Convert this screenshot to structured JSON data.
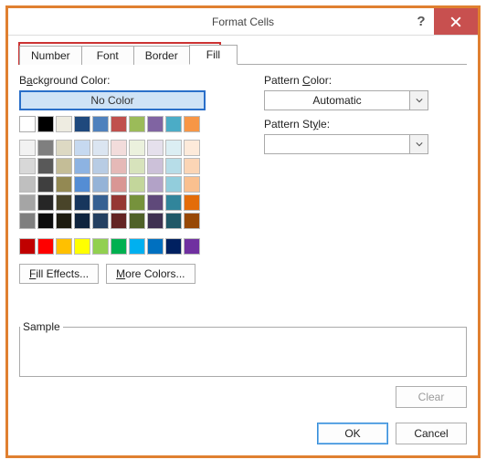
{
  "title": "Format Cells",
  "tabs": {
    "number": "Number",
    "font": "Font",
    "border": "Border",
    "fill": "Fill"
  },
  "active_tab": "fill",
  "bg_label_pre": "B",
  "bg_label_u": "a",
  "bg_label_post": "ckground Color:",
  "no_color": "No Color",
  "fill_effects_u": "F",
  "fill_effects_post": "ill Effects...",
  "more_colors_u": "M",
  "more_colors_post": "ore Colors...",
  "pat_color_pre": "Pattern ",
  "pat_color_u": "C",
  "pat_color_post": "olor:",
  "pat_color_value": "Automatic",
  "pat_style_pre": "Pattern St",
  "pat_style_u": "y",
  "pat_style_post": "le:",
  "pat_style_value": "",
  "sample_label": "Sample",
  "clear_u": "",
  "clear_label": "Clear",
  "ok_label": "OK",
  "cancel_label": "Cancel",
  "chart_data": {
    "type": "table",
    "title": "Fill color palette",
    "theme_colors_row1": [
      "#FFFFFF",
      "#000000",
      "#EEECE1",
      "#1F497D",
      "#4F81BD",
      "#C0504D",
      "#9BBB59",
      "#8064A2",
      "#4BACC6",
      "#F79646"
    ],
    "theme_tints": [
      [
        "#F2F2F2",
        "#7F7F7F",
        "#DDD9C3",
        "#C6D9F0",
        "#DBE5F1",
        "#F2DCDB",
        "#EBF1DD",
        "#E5E0EC",
        "#DBEEF3",
        "#FDEADA"
      ],
      [
        "#D8D8D8",
        "#595959",
        "#C4BD97",
        "#8DB3E2",
        "#B8CCE4",
        "#E5B9B7",
        "#D7E3BC",
        "#CCC1D9",
        "#B7DDE8",
        "#FBD5B5"
      ],
      [
        "#BFBFBF",
        "#3F3F3F",
        "#938953",
        "#548DD4",
        "#95B3D7",
        "#D99694",
        "#C3D69B",
        "#B2A2C7",
        "#92CDDC",
        "#FAC08F"
      ],
      [
        "#A5A5A5",
        "#262626",
        "#494429",
        "#17365D",
        "#366092",
        "#953734",
        "#76923C",
        "#5F497A",
        "#31859B",
        "#E36C09"
      ],
      [
        "#7F7F7F",
        "#0C0C0C",
        "#1D1B10",
        "#0F243E",
        "#244061",
        "#632423",
        "#4F6128",
        "#3F3151",
        "#205867",
        "#974806"
      ]
    ],
    "standard_colors": [
      "#C00000",
      "#FF0000",
      "#FFC000",
      "#FFFF00",
      "#92D050",
      "#00B050",
      "#00B0F0",
      "#0070C0",
      "#002060",
      "#7030A0"
    ]
  }
}
